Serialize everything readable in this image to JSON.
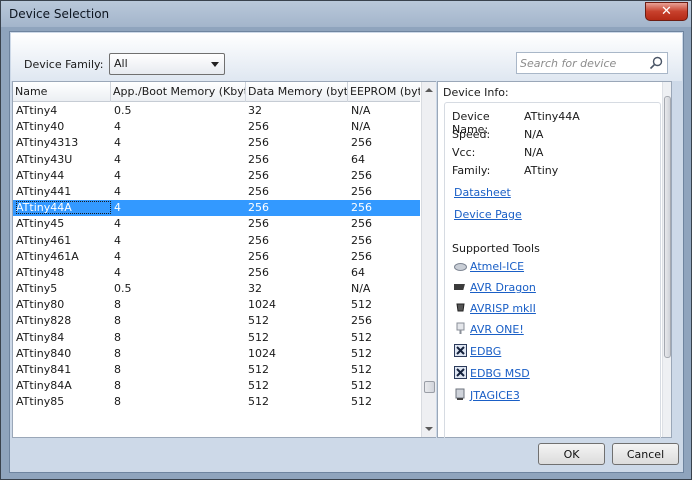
{
  "window": {
    "title": "Device Selection",
    "close_label": "✕"
  },
  "filter": {
    "family_label": "Device Family:",
    "family_value": "All",
    "search_placeholder": "Search for device"
  },
  "grid": {
    "columns": [
      "Name",
      "App./Boot Memory (Kbytes)",
      "Data Memory (bytes)",
      "EEPROM (bytes)"
    ],
    "selected_index": 6,
    "rows": [
      [
        "ATtiny4",
        "0.5",
        "32",
        "N/A"
      ],
      [
        "ATtiny40",
        "4",
        "256",
        "N/A"
      ],
      [
        "ATtiny4313",
        "4",
        "256",
        "256"
      ],
      [
        "ATtiny43U",
        "4",
        "256",
        "64"
      ],
      [
        "ATtiny44",
        "4",
        "256",
        "256"
      ],
      [
        "ATtiny441",
        "4",
        "256",
        "256"
      ],
      [
        "ATtiny44A",
        "4",
        "256",
        "256"
      ],
      [
        "ATtiny45",
        "4",
        "256",
        "256"
      ],
      [
        "ATtiny461",
        "4",
        "256",
        "256"
      ],
      [
        "ATtiny461A",
        "4",
        "256",
        "256"
      ],
      [
        "ATtiny48",
        "4",
        "256",
        "64"
      ],
      [
        "ATtiny5",
        "0.5",
        "32",
        "N/A"
      ],
      [
        "ATtiny80",
        "8",
        "1024",
        "512"
      ],
      [
        "ATtiny828",
        "8",
        "512",
        "256"
      ],
      [
        "ATtiny84",
        "8",
        "512",
        "512"
      ],
      [
        "ATtiny840",
        "8",
        "1024",
        "512"
      ],
      [
        "ATtiny841",
        "8",
        "512",
        "512"
      ],
      [
        "ATtiny84A",
        "8",
        "512",
        "512"
      ],
      [
        "ATtiny85",
        "8",
        "512",
        "512"
      ]
    ]
  },
  "info": {
    "title": "Device Info:",
    "device_name_label": "Device Name:",
    "device_name": "ATtiny44A",
    "speed_label": "Speed:",
    "speed": "N/A",
    "vcc_label": "Vcc:",
    "vcc": "N/A",
    "family_label": "Family:",
    "family": "ATtiny",
    "datasheet_link": "Datasheet",
    "device_page_link": "Device Page",
    "tools_label": "Supported Tools",
    "tools": [
      {
        "name": "Atmel-ICE",
        "icon": "atmel-ice-icon"
      },
      {
        "name": "AVR Dragon",
        "icon": "avr-dragon-icon"
      },
      {
        "name": "AVRISP mkII",
        "icon": "avrisp-icon"
      },
      {
        "name": "AVR ONE!",
        "icon": "avr-one-icon"
      },
      {
        "name": "EDBG",
        "icon": "edbg-icon"
      },
      {
        "name": "EDBG MSD",
        "icon": "edbg-msd-icon"
      },
      {
        "name": "JTAGICE3",
        "icon": "jtagice3-icon"
      }
    ]
  },
  "buttons": {
    "ok": "OK",
    "cancel": "Cancel"
  }
}
